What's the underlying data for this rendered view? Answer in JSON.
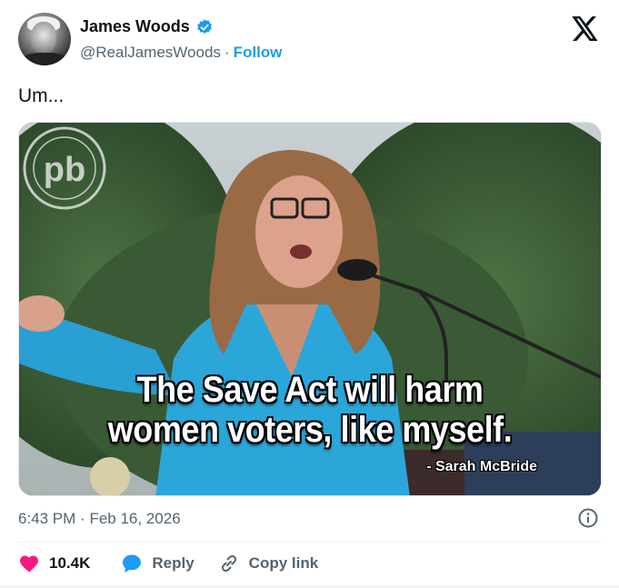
{
  "author": {
    "name": "James Woods",
    "handle": "@RealJamesWoods",
    "separator": "·",
    "follow_label": "Follow",
    "verified_icon": "verified-badge-icon",
    "avatar_icon": "avatar"
  },
  "platform_icon": "x-logo-icon",
  "tweet": {
    "text": "Um..."
  },
  "media": {
    "caption_line1": "The Save Act will harm",
    "caption_line2": "women voters, like myself.",
    "attribution": "- Sarah McBride",
    "watermark": "pb"
  },
  "meta": {
    "time": "6:43 PM",
    "separator": "·",
    "date": "Feb 16, 2026",
    "info_icon": "info-icon"
  },
  "actions": {
    "likes_count": "10.4K",
    "reply_label": "Reply",
    "copy_link_label": "Copy link"
  },
  "colors": {
    "accent": "#1d9bf0",
    "like": "#f91880",
    "secondary_text": "#536471",
    "primary_text": "#0f1419"
  }
}
